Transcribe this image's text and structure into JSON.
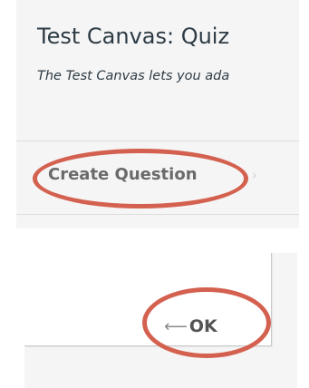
{
  "header": {
    "title": "Test Canvas: Quiz",
    "description": "The Test Canvas lets you ada"
  },
  "breadcrumb": {
    "link_label": "Create Question",
    "separator_icon": "chevron-right-icon"
  },
  "dialog": {
    "ok_arrow": "⟵",
    "ok_label": "OK"
  },
  "annotations": {
    "highlight_color": "#d4614f"
  }
}
